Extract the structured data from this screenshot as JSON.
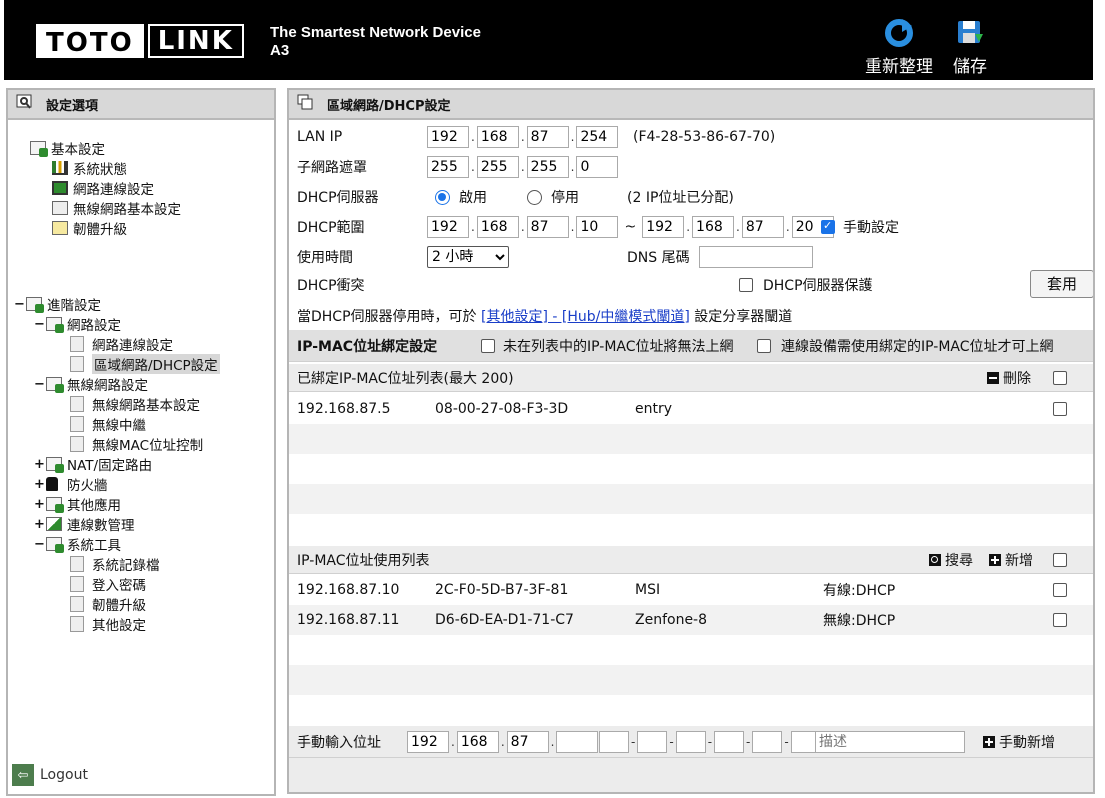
{
  "header": {
    "logo_left": "TOTO",
    "logo_right": "LINK",
    "tagline": "The Smartest Network Device",
    "model": "A3",
    "reboot_label": "重新整理",
    "save_label": "儲存"
  },
  "sidebar": {
    "title": "設定選項",
    "basic": {
      "label": "基本設定",
      "items": [
        "系統狀態",
        "網路連線設定",
        "無線網路基本設定",
        "韌體升級"
      ]
    },
    "advanced": {
      "label": "進階設定",
      "network": {
        "label": "網路設定",
        "items": [
          "網路連線設定",
          "區域網路/DHCP設定"
        ]
      },
      "wireless": {
        "label": "無線網路設定",
        "items": [
          "無線網路基本設定",
          "無線中繼",
          "無線MAC位址控制"
        ]
      },
      "nat": "NAT/固定路由",
      "firewall": "防火牆",
      "other_apps": "其他應用",
      "traffic": "連線數管理",
      "tools": {
        "label": "系統工具",
        "items": [
          "系統記錄檔",
          "登入密碼",
          "韌體升級",
          "其他設定"
        ]
      }
    },
    "logout": "Logout"
  },
  "main": {
    "title": "區域網路/DHCP設定",
    "lan_ip": {
      "label": "LAN IP",
      "octets": [
        "192",
        "168",
        "87",
        "254"
      ],
      "mac": "(F4-28-53-86-67-70)"
    },
    "subnet": {
      "label": "子網路遮罩",
      "octets": [
        "255",
        "255",
        "255",
        "0"
      ]
    },
    "dhcp_server": {
      "label": "DHCP伺服器",
      "enable": "啟用",
      "disable": "停用",
      "status": "(2 IP位址已分配)"
    },
    "dhcp_range": {
      "label": "DHCP範圍",
      "start": [
        "192",
        "168",
        "87",
        "10"
      ],
      "end": [
        "192",
        "168",
        "87",
        "20"
      ],
      "manual": "手動設定"
    },
    "lease": {
      "label": "使用時間",
      "value": "2 小時",
      "dns_label": "DNS 尾碼",
      "dns_value": ""
    },
    "conflict": {
      "label": "DHCP衝突",
      "protect": "DHCP伺服器保護",
      "apply": "套用"
    },
    "note": {
      "prefix": "當DHCP伺服器停用時，可於 ",
      "link": "[其他設定] - [Hub/中繼模式闡道]",
      "suffix": " 設定分享器闡道"
    },
    "binding": {
      "title": "IP-MAC位址綁定設定",
      "opt1": "未在列表中的IP-MAC位址將無法上網",
      "opt2": "連線設備需使用綁定的IP-MAC位址才可上網"
    },
    "bound_list": {
      "title": "已綁定IP-MAC位址列表(最大 200)",
      "delete": "刪除",
      "rows": [
        {
          "ip": "192.168.87.5",
          "mac": "08-00-27-08-F3-3D",
          "name": "entry"
        }
      ]
    },
    "usage_list": {
      "title": "IP-MAC位址使用列表",
      "search": "搜尋",
      "add": "新增",
      "rows": [
        {
          "ip": "192.168.87.10",
          "mac": "2C-F0-5D-B7-3F-81",
          "name": "MSI",
          "type": "有線:DHCP"
        },
        {
          "ip": "192.168.87.11",
          "mac": "D6-6D-EA-D1-71-C7",
          "name": "Zenfone-8",
          "type": "無線:DHCP"
        }
      ]
    },
    "manual": {
      "label": "手動輸入位址",
      "octets": [
        "192",
        "168",
        "87",
        ""
      ],
      "desc_placeholder": "描述",
      "add": "手動新增"
    }
  }
}
